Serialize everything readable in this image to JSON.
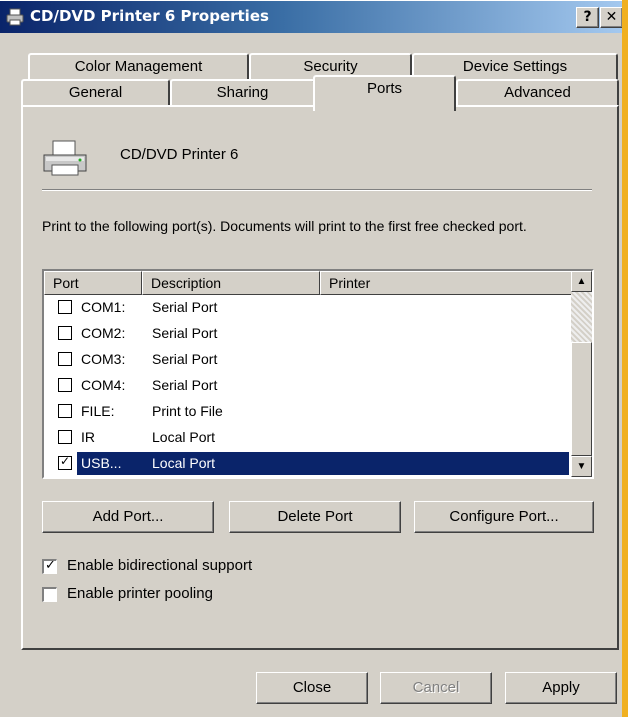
{
  "window": {
    "title": "CD/DVD Printer 6 Properties",
    "help_label": "?",
    "close_label": "✕"
  },
  "tabs": {
    "back": [
      "Color Management",
      "Security",
      "Device Settings"
    ],
    "front": [
      "General",
      "Sharing",
      "Ports",
      "Advanced"
    ],
    "selected": "Ports"
  },
  "printer": {
    "name": "CD/DVD Printer 6",
    "icon": "printer-icon"
  },
  "description": "Print to the following port(s). Documents will print to the first free checked port.",
  "list": {
    "columns": [
      "Port",
      "Description",
      "Printer"
    ],
    "rows": [
      {
        "port": "COM1:",
        "description": "Serial Port",
        "printer": "",
        "checked": false
      },
      {
        "port": "COM2:",
        "description": "Serial Port",
        "printer": "",
        "checked": false
      },
      {
        "port": "COM3:",
        "description": "Serial Port",
        "printer": "",
        "checked": false
      },
      {
        "port": "COM4:",
        "description": "Serial Port",
        "printer": "",
        "checked": false
      },
      {
        "port": "FILE:",
        "description": "Print to File",
        "printer": "",
        "checked": false
      },
      {
        "port": "IR",
        "description": "Local Port",
        "printer": "",
        "checked": false
      },
      {
        "port": "USB...",
        "description": "Local Port",
        "printer": "",
        "checked": true,
        "selected": true
      }
    ]
  },
  "port_buttons": {
    "add": "Add Port...",
    "delete": "Delete Port",
    "configure": "Configure Port..."
  },
  "options": {
    "bidirectional": {
      "label": "Enable bidirectional support",
      "checked": true
    },
    "pooling": {
      "label": "Enable printer pooling",
      "checked": false
    }
  },
  "dialog_buttons": {
    "close": "Close",
    "cancel": "Cancel",
    "apply": "Apply"
  },
  "colors": {
    "selection": "#0a246a",
    "face": "#d4d0c8",
    "accent_strip": "#f0b020"
  }
}
